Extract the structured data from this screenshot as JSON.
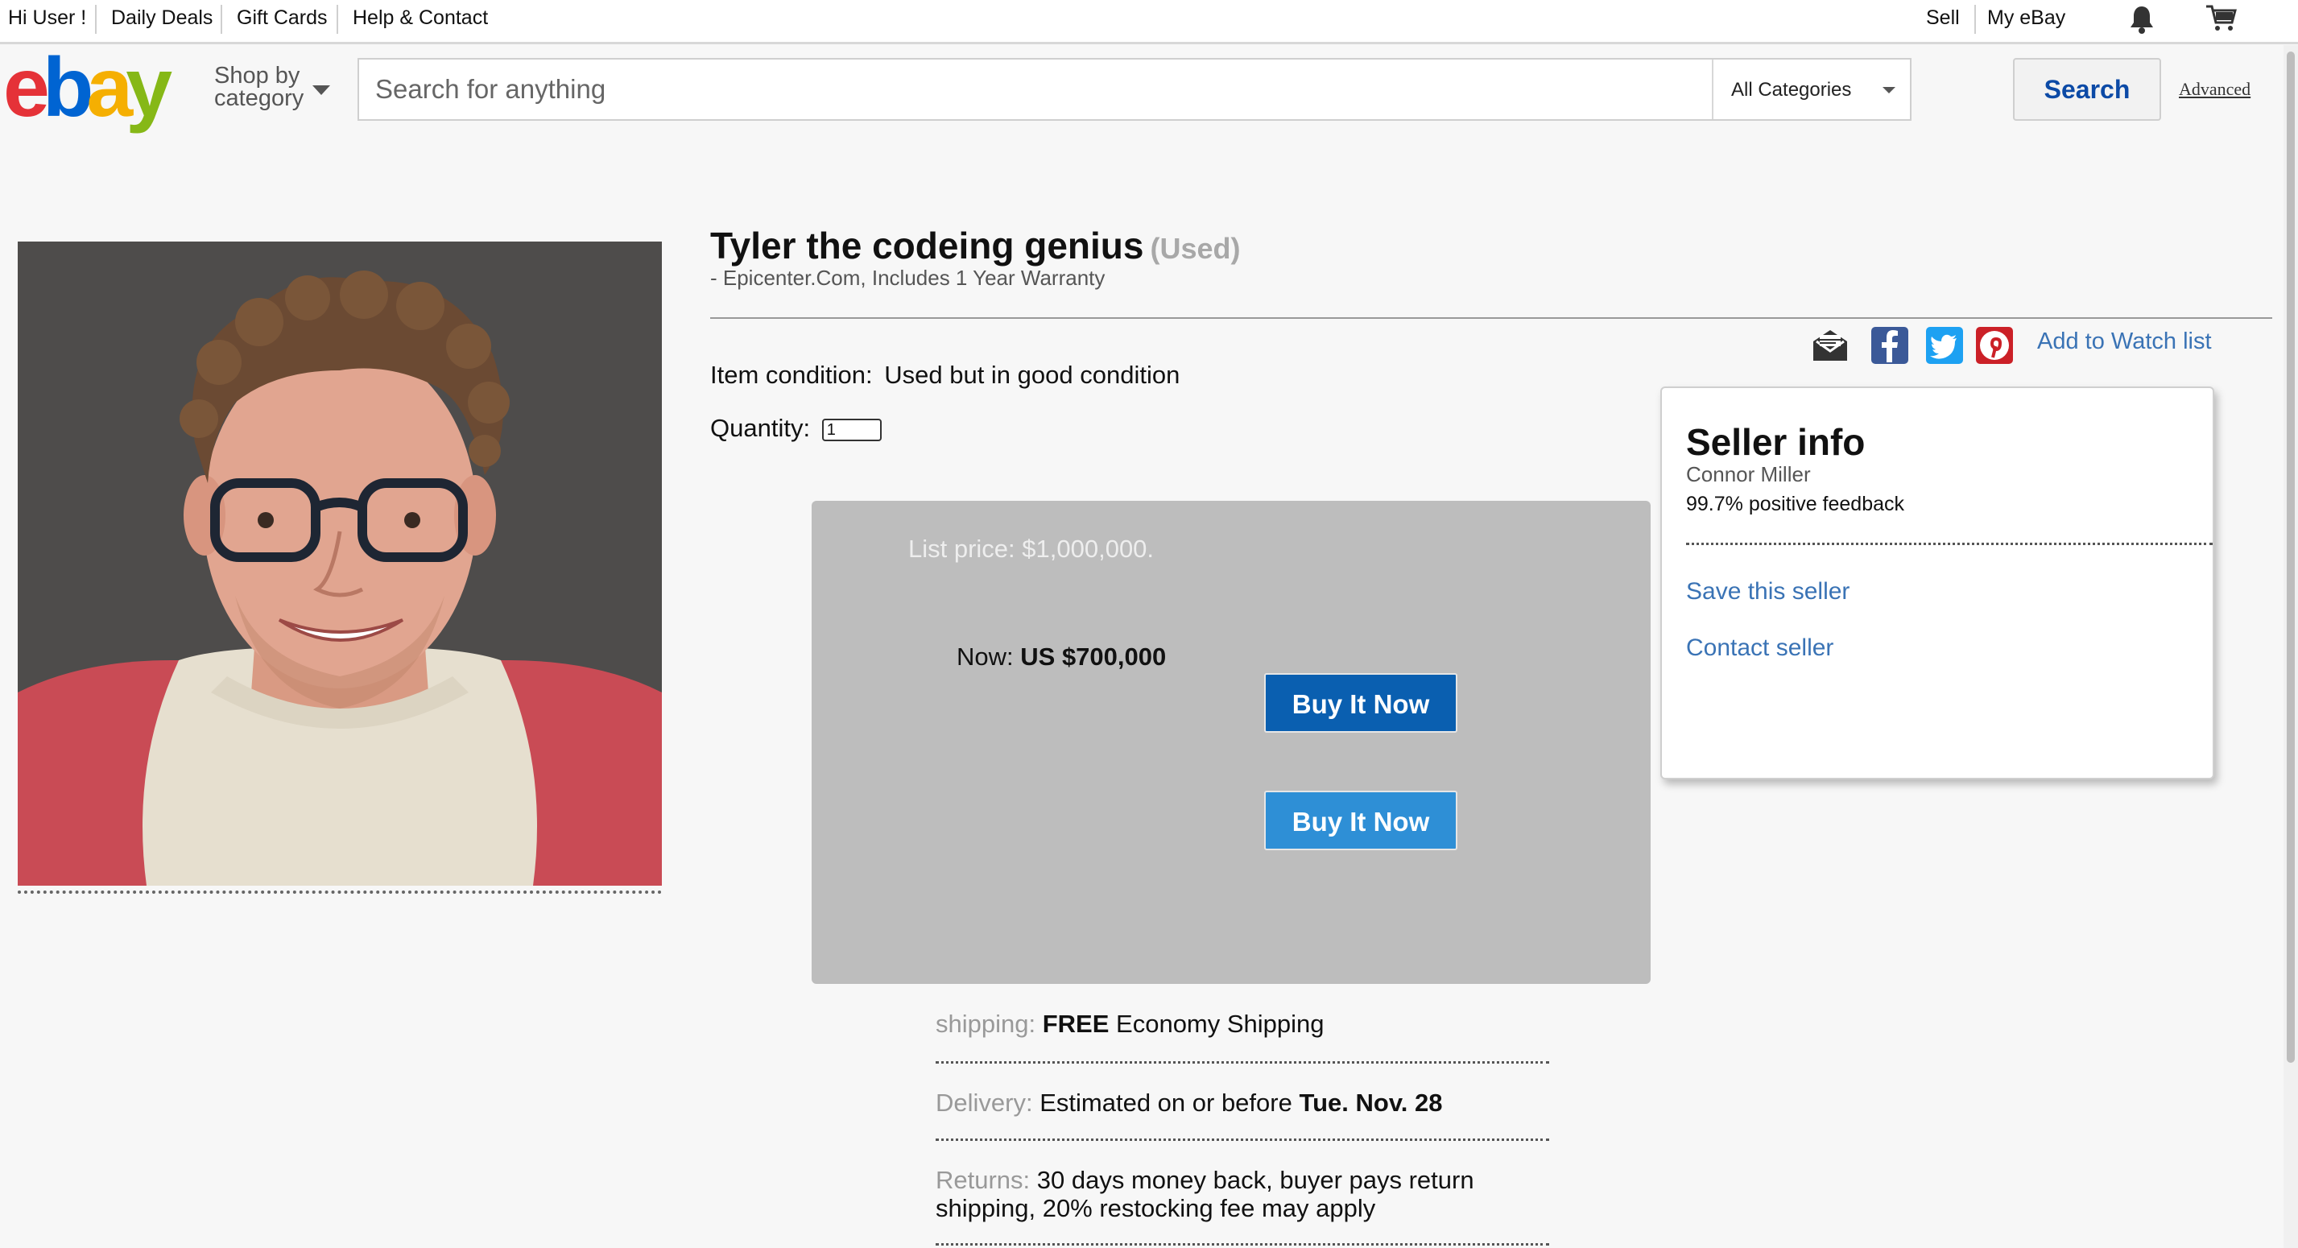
{
  "topbar": {
    "greeting": "Hi User !",
    "daily_deals": "Daily Deals",
    "gift_cards": "Gift Cards",
    "help": "Help & Contact",
    "sell": "Sell",
    "my_ebay": "My eBay",
    "icons": [
      "bell-icon",
      "cart-icon"
    ]
  },
  "header": {
    "logo_text": "ebay",
    "logo_colors": [
      "#e53238",
      "#0064d2",
      "#f5af02",
      "#86b817"
    ],
    "shop_by": "Shop by",
    "category": "category",
    "search_placeholder": "Search for anything",
    "category_select": "All Categories",
    "search_button": "Search",
    "advanced": "Advanced"
  },
  "item": {
    "title": "Tyler the codeing genius",
    "condition_badge": "(Used)",
    "subtitle": "- Epicenter.Com, Includes 1 Year Warranty",
    "condition_label": "Item condition:",
    "condition_value": "Used but in good condition",
    "quantity_label": "Quantity:",
    "quantity_value": "1"
  },
  "share": {
    "icons": [
      "email-icon",
      "facebook-icon",
      "twitter-icon",
      "pinterest-icon"
    ],
    "watch_list": "Add to Watch list"
  },
  "pricing": {
    "list_price": "List price: $1,000,000.",
    "now_label": "Now:",
    "now_value": "US $700,000",
    "buy_now_1": "Buy It Now",
    "buy_now_2": "Buy It Now"
  },
  "seller": {
    "title": "Seller info",
    "name": "Connor Miller",
    "feedback": "99.7% positive feedback",
    "save": "Save this seller",
    "contact": "Contact seller"
  },
  "details": {
    "shipping_label": "shipping:",
    "shipping_free": "FREE",
    "shipping_value": "Economy Shipping",
    "delivery_label": "Delivery:",
    "delivery_value": "Estimated on or before",
    "delivery_date": "Tue. Nov. 28",
    "returns_label": "Returns:",
    "returns_value": "30 days money back, buyer pays return shipping, 20% restocking fee may apply"
  },
  "colors": {
    "link_blue": "#3a73b5",
    "buy_primary": "#0a5fb0",
    "buy_secondary": "#2e8fd6",
    "price_box": "#bdbdbd"
  }
}
